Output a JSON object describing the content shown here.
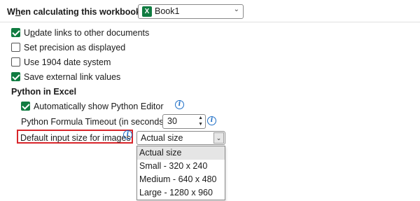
{
  "header": {
    "label": "When calculating this workbook:",
    "underline_char": "h",
    "workbook": "Book1"
  },
  "options": [
    {
      "label": "Update links to other documents",
      "checked": true
    },
    {
      "label": "Set precision as displayed",
      "checked": false
    },
    {
      "label": "Use 1904 date system",
      "checked": false
    },
    {
      "label": "Save external link values",
      "checked": true
    }
  ],
  "python": {
    "section_title": "Python in Excel",
    "auto_show_label": "Automatically show Python Editor",
    "auto_show_checked": true,
    "timeout_label": "Python Formula Timeout (in seconds)",
    "timeout_value": "30",
    "image_size_label": "Default input size for images",
    "image_size_value": "Actual size",
    "image_size_options": [
      "Actual size",
      "Small - 320 x 240",
      "Medium - 640 x 480",
      "Large - 1280 x 960"
    ]
  },
  "colors": {
    "accent": "#107c41",
    "highlight": "#d8262b",
    "info": "#1f6fc6"
  },
  "icons": {
    "workbook": "excel-icon",
    "info": "info-icon",
    "dropdown": "chevron-down-icon"
  }
}
